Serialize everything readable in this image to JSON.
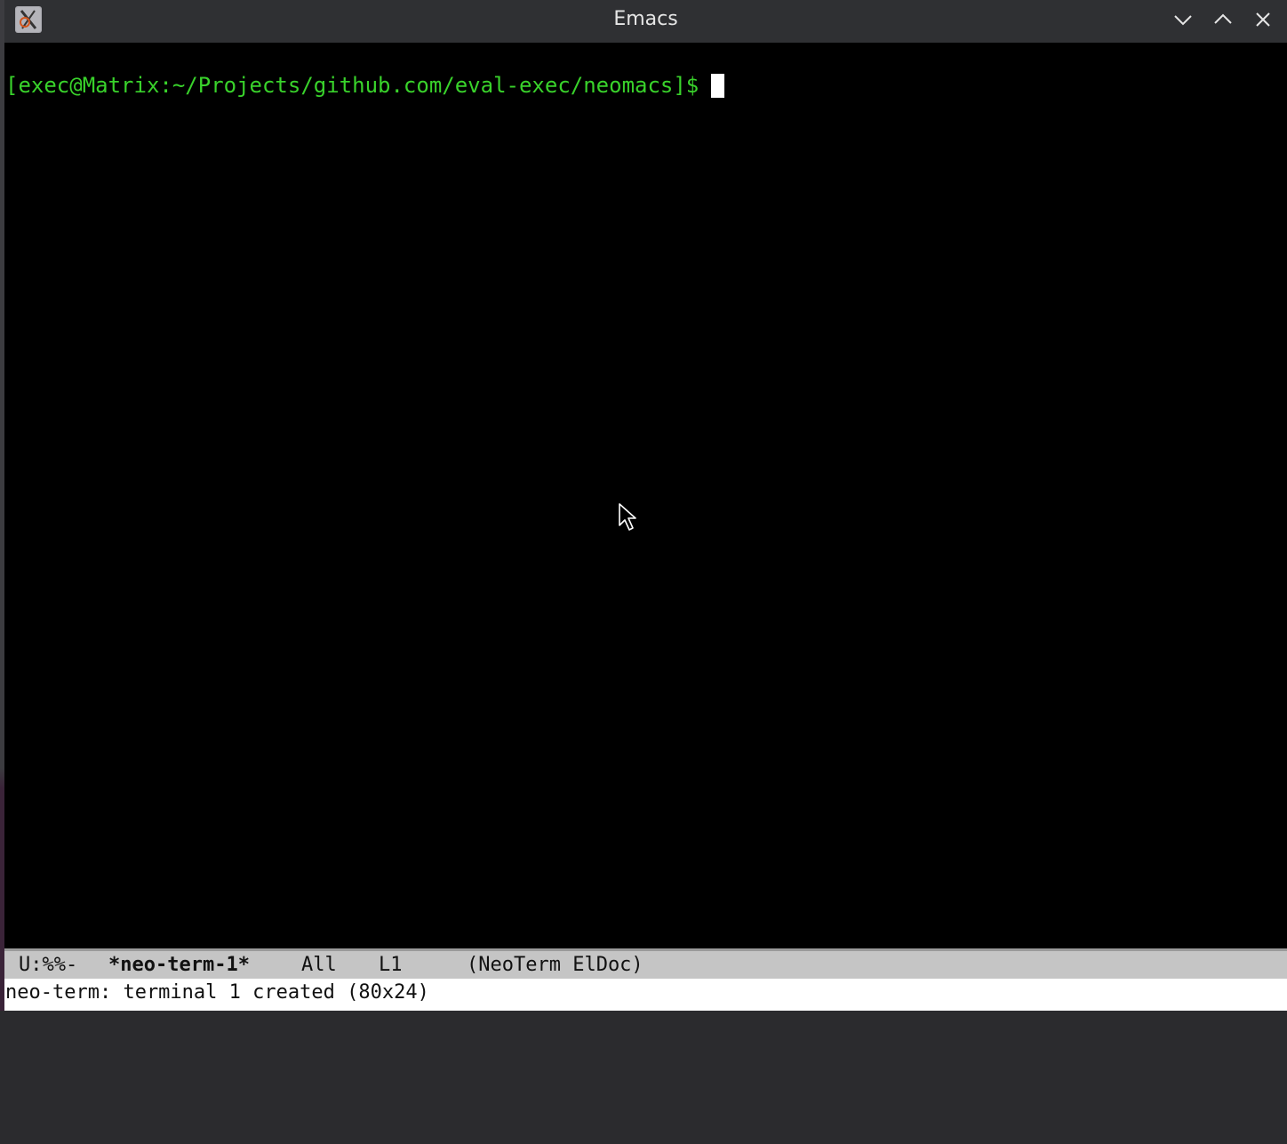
{
  "window": {
    "title": "Emacs",
    "app_icon": "emacs-x-icon",
    "buttons": {
      "minimize_icon": "chevron-down-icon",
      "maximize_icon": "chevron-up-icon",
      "close_icon": "close-icon"
    }
  },
  "terminal": {
    "prompt": "[exec@Matrix:~/Projects/github.com/eval-exec/neomacs]$",
    "prompt_color": "#39d22b",
    "background": "#000000"
  },
  "modeline": {
    "status": "U:%%-",
    "buffer_name": "*neo-term-1*",
    "position": "All",
    "line": "L1",
    "modes": "(NeoTerm ElDoc)"
  },
  "echo_area": {
    "message": "neo-term: terminal 1 created (80x24)"
  }
}
